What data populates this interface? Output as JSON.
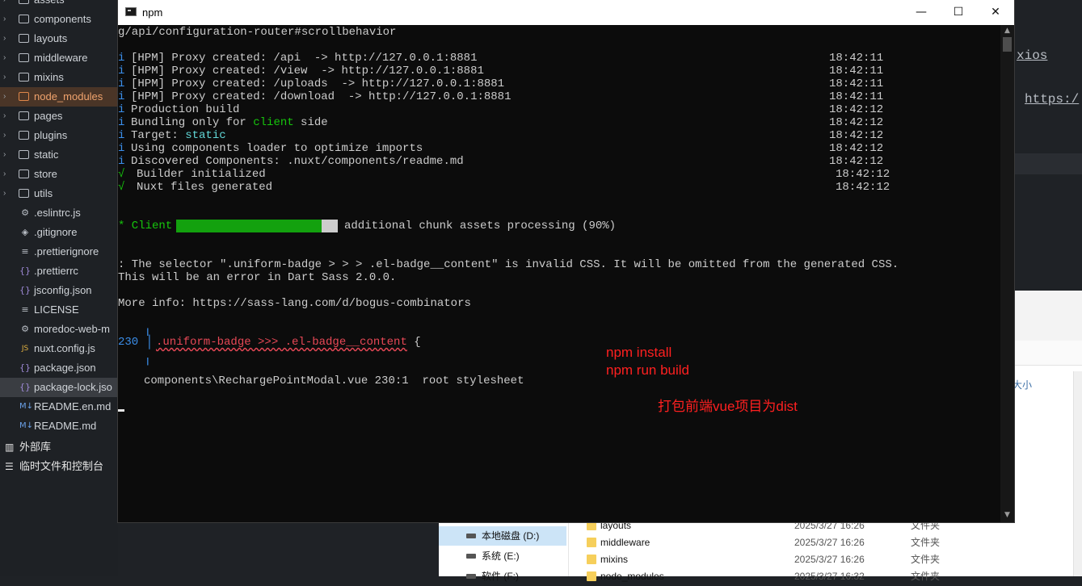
{
  "explorer": {
    "items": [
      {
        "label": "assets",
        "kind": "folder"
      },
      {
        "label": "components",
        "kind": "folder"
      },
      {
        "label": "layouts",
        "kind": "folder"
      },
      {
        "label": "middleware",
        "kind": "folder"
      },
      {
        "label": "mixins",
        "kind": "folder"
      },
      {
        "label": "node_modules",
        "kind": "folder-highlight"
      },
      {
        "label": "pages",
        "kind": "folder"
      },
      {
        "label": "plugins",
        "kind": "folder"
      },
      {
        "label": "static",
        "kind": "folder"
      },
      {
        "label": "store",
        "kind": "folder"
      },
      {
        "label": "utils",
        "kind": "folder"
      },
      {
        "label": ".eslintrc.js",
        "kind": "file",
        "icon": "gear-icon",
        "glyph": "⚙"
      },
      {
        "label": ".gitignore",
        "kind": "file",
        "icon": "git-icon",
        "glyph": "◈"
      },
      {
        "label": ".prettierignore",
        "kind": "file",
        "icon": "text-file-icon",
        "glyph": "≡"
      },
      {
        "label": ".prettierrc",
        "kind": "file",
        "icon": "braces-icon",
        "glyph": "{}"
      },
      {
        "label": "jsconfig.json",
        "kind": "file",
        "icon": "braces-icon",
        "glyph": "{}"
      },
      {
        "label": "LICENSE",
        "kind": "file",
        "icon": "text-file-icon",
        "glyph": "≡"
      },
      {
        "label": "moredoc-web-m",
        "kind": "file",
        "icon": "gear-icon",
        "glyph": "⚙"
      },
      {
        "label": "nuxt.config.js",
        "kind": "file",
        "icon": "js-file-icon",
        "glyph": "JS"
      },
      {
        "label": "package.json",
        "kind": "file",
        "icon": "braces-icon",
        "glyph": "{}"
      },
      {
        "label": "package-lock.jso",
        "kind": "file",
        "icon": "braces-icon",
        "glyph": "{}"
      },
      {
        "label": "README.en.md",
        "kind": "file",
        "icon": "markdown-icon",
        "glyph": "M↓"
      },
      {
        "label": "README.md",
        "kind": "file",
        "icon": "markdown-icon",
        "glyph": "M↓"
      }
    ],
    "external_libs": "外部库",
    "scratches": "临时文件和控制台"
  },
  "editor_bg": {
    "link1": "xios",
    "link2": "https:/"
  },
  "win_explorer": {
    "column_header": "大小",
    "nav": [
      {
        "label": "本地磁盘 (D:)"
      },
      {
        "label": "系统 (E:)"
      },
      {
        "label": "软件 (F:)"
      }
    ],
    "files": [
      {
        "name": "layouts",
        "date": "2025/3/27 16:26",
        "type": "文件夹"
      },
      {
        "name": "middleware",
        "date": "2025/3/27 16:26",
        "type": "文件夹"
      },
      {
        "name": "mixins",
        "date": "2025/3/27 16:26",
        "type": "文件夹"
      },
      {
        "name": "node_modules",
        "date": "2025/3/27 16:32",
        "type": "文件夹"
      }
    ]
  },
  "terminal": {
    "title": "npm",
    "controls": {
      "minimize": "—",
      "maximize": "☐",
      "close": "✕"
    },
    "line0": "g/api/configuration-router#scrollbehavior",
    "logs": [
      {
        "prefix": "i",
        "text": "[HPM] Proxy created: /api  -> http://127.0.0.1:8881",
        "time": "18:42:11"
      },
      {
        "prefix": "i",
        "text": "[HPM] Proxy created: /view  -> http://127.0.0.1:8881",
        "time": "18:42:11"
      },
      {
        "prefix": "i",
        "text": "[HPM] Proxy created: /uploads  -> http://127.0.0.1:8881",
        "time": "18:42:11"
      },
      {
        "prefix": "i",
        "text": "[HPM] Proxy created: /download  -> http://127.0.0.1:8881",
        "time": "18:42:11"
      },
      {
        "prefix": "i",
        "text": "Production build",
        "time": "18:42:12"
      }
    ],
    "bundling": {
      "a": "Bundling only for ",
      "b": "client",
      "c": " side",
      "time": "18:42:12"
    },
    "target": {
      "a": "Target: ",
      "b": "static",
      "time": "18:42:12"
    },
    "logs2": [
      {
        "prefix": "i",
        "text": "Using components loader to optimize imports",
        "time": "18:42:12"
      },
      {
        "prefix": "i",
        "text": "Discovered Components: .nuxt/components/readme.md",
        "time": "18:42:12"
      }
    ],
    "success": [
      {
        "prefix": "√",
        "text": "Builder initialized",
        "time": "18:42:12"
      },
      {
        "prefix": "√",
        "text": "Nuxt files generated",
        "time": "18:42:12"
      }
    ],
    "client": {
      "label": "* Client",
      "status": "additional chunk assets processing (90%)",
      "progress": 0.9
    },
    "warning1": ": The selector \".uniform-badge > > > .el-badge__content\" is invalid CSS. It will be omitted from the generated CSS.",
    "warning2": "This will be an error in Dart Sass 2.0.0.",
    "more_info": "More info: https://sass-lang.com/d/bogus-combinators",
    "code_line_no": "230",
    "code_sel": ".uniform-badge >>> .el-badge__content",
    "code_brace": " {",
    "location": "components\\RechargePointModal.vue 230:1  root stylesheet",
    "bracket_top": "╷",
    "bracket_mid": "│",
    "bracket_bot": "╵"
  },
  "annotations": {
    "line1": "npm install",
    "line2": "npm run build",
    "line3": "打包前端vue项目为dist"
  }
}
